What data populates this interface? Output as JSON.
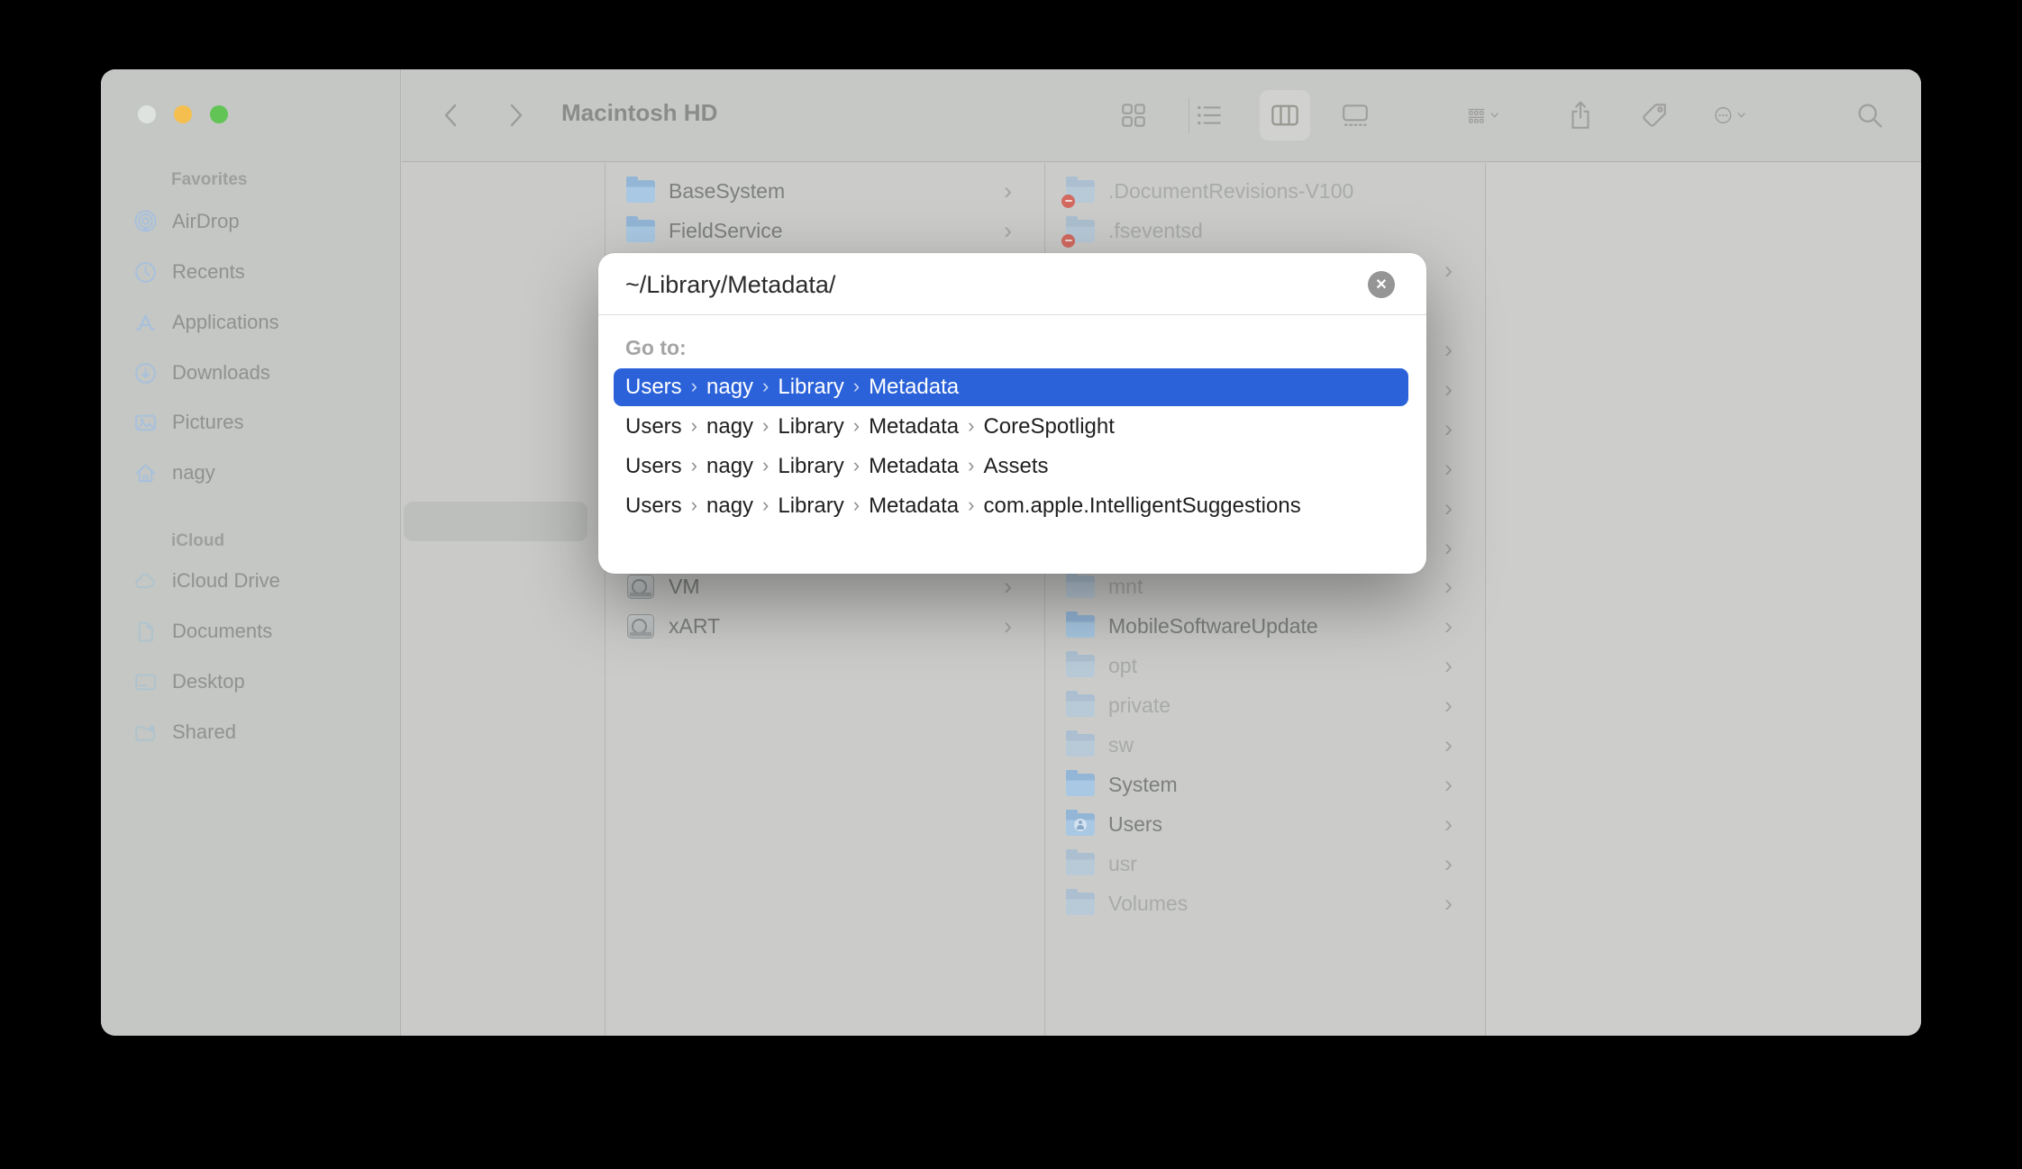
{
  "window": {
    "title": "Macintosh HD"
  },
  "glyphs": {
    "chevron": "›",
    "back": "‹",
    "forward": "›",
    "close_x": "✕"
  },
  "sidebar": {
    "sections": [
      {
        "title": "Favorites",
        "items": [
          {
            "label": "AirDrop"
          },
          {
            "label": "Recents"
          },
          {
            "label": "Applications"
          },
          {
            "label": "Downloads"
          },
          {
            "label": "Pictures"
          },
          {
            "label": "nagy"
          }
        ]
      },
      {
        "title": "iCloud",
        "items": [
          {
            "label": "iCloud Drive"
          },
          {
            "label": "Documents"
          },
          {
            "label": "Desktop"
          },
          {
            "label": "Shared"
          }
        ]
      }
    ]
  },
  "finder_columns": {
    "column2": {
      "items_top": [
        {
          "label": "BaseSystem",
          "type": "folder"
        },
        {
          "label": "FieldService",
          "type": "folder"
        }
      ],
      "items_bottom": [
        {
          "label": "VM",
          "type": "disk"
        },
        {
          "label": "xART",
          "type": "disk"
        }
      ]
    },
    "column3": {
      "items_top": [
        {
          "label": ".DocumentRevisions-V100",
          "type": "folder",
          "restricted": true
        },
        {
          "label": ".fseventsd",
          "type": "folder",
          "restricted": true
        }
      ],
      "items_bottom": [
        {
          "label": "mnt",
          "faded": true
        },
        {
          "label": "MobileSoftwareUpdate",
          "faded": false
        },
        {
          "label": "opt",
          "faded": true
        },
        {
          "label": "private",
          "faded": true
        },
        {
          "label": "sw",
          "faded": true
        },
        {
          "label": "System",
          "faded": false
        },
        {
          "label": "Users",
          "faded": false,
          "badge": "person"
        },
        {
          "label": "usr",
          "faded": true
        },
        {
          "label": "Volumes",
          "faded": true
        }
      ]
    }
  },
  "dialog": {
    "path_value": "~/Library/Metadata/",
    "goto_label": "Go to:",
    "separator": "›",
    "suggestions": [
      {
        "selected": true,
        "segments": [
          "Users",
          "nagy",
          "Library",
          "Metadata"
        ]
      },
      {
        "selected": false,
        "segments": [
          "Users",
          "nagy",
          "Library",
          "Metadata",
          "CoreSpotlight"
        ]
      },
      {
        "selected": false,
        "segments": [
          "Users",
          "nagy",
          "Library",
          "Metadata",
          "Assets"
        ]
      },
      {
        "selected": false,
        "segments": [
          "Users",
          "nagy",
          "Library",
          "Metadata",
          "com.apple.IntelligentSuggestions"
        ]
      }
    ]
  },
  "colors": {
    "selection_blue": "#2b62d9",
    "folder_blue": "#a9c8e3",
    "sidebar_bg": "#c4c7c3",
    "desktop_bg": "#000000"
  }
}
